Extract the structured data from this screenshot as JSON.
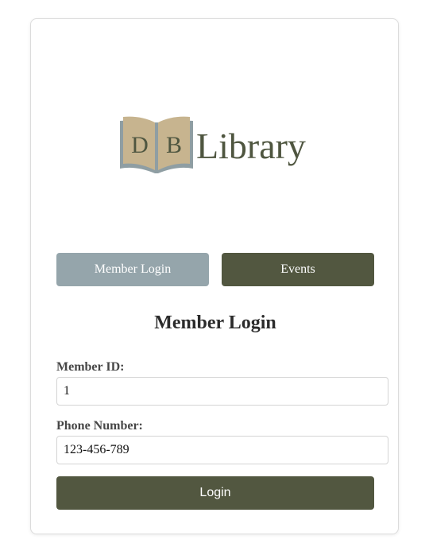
{
  "logo": {
    "letters": [
      "D",
      "B"
    ],
    "name": "Library",
    "icon": "open-book-icon"
  },
  "tabs": {
    "member_login": "Member Login",
    "events": "Events"
  },
  "form": {
    "heading": "Member Login",
    "member_id_label": "Member ID:",
    "member_id_value": "1",
    "phone_label": "Phone Number:",
    "phone_value": "123-456-789",
    "submit_label": "Login"
  },
  "colors": {
    "tab_active": "#95a5ab",
    "accent_dark": "#525740",
    "book_page": "#c7b48f",
    "logo_text": "#4f5640",
    "book_edge": "#8f9ea3"
  }
}
